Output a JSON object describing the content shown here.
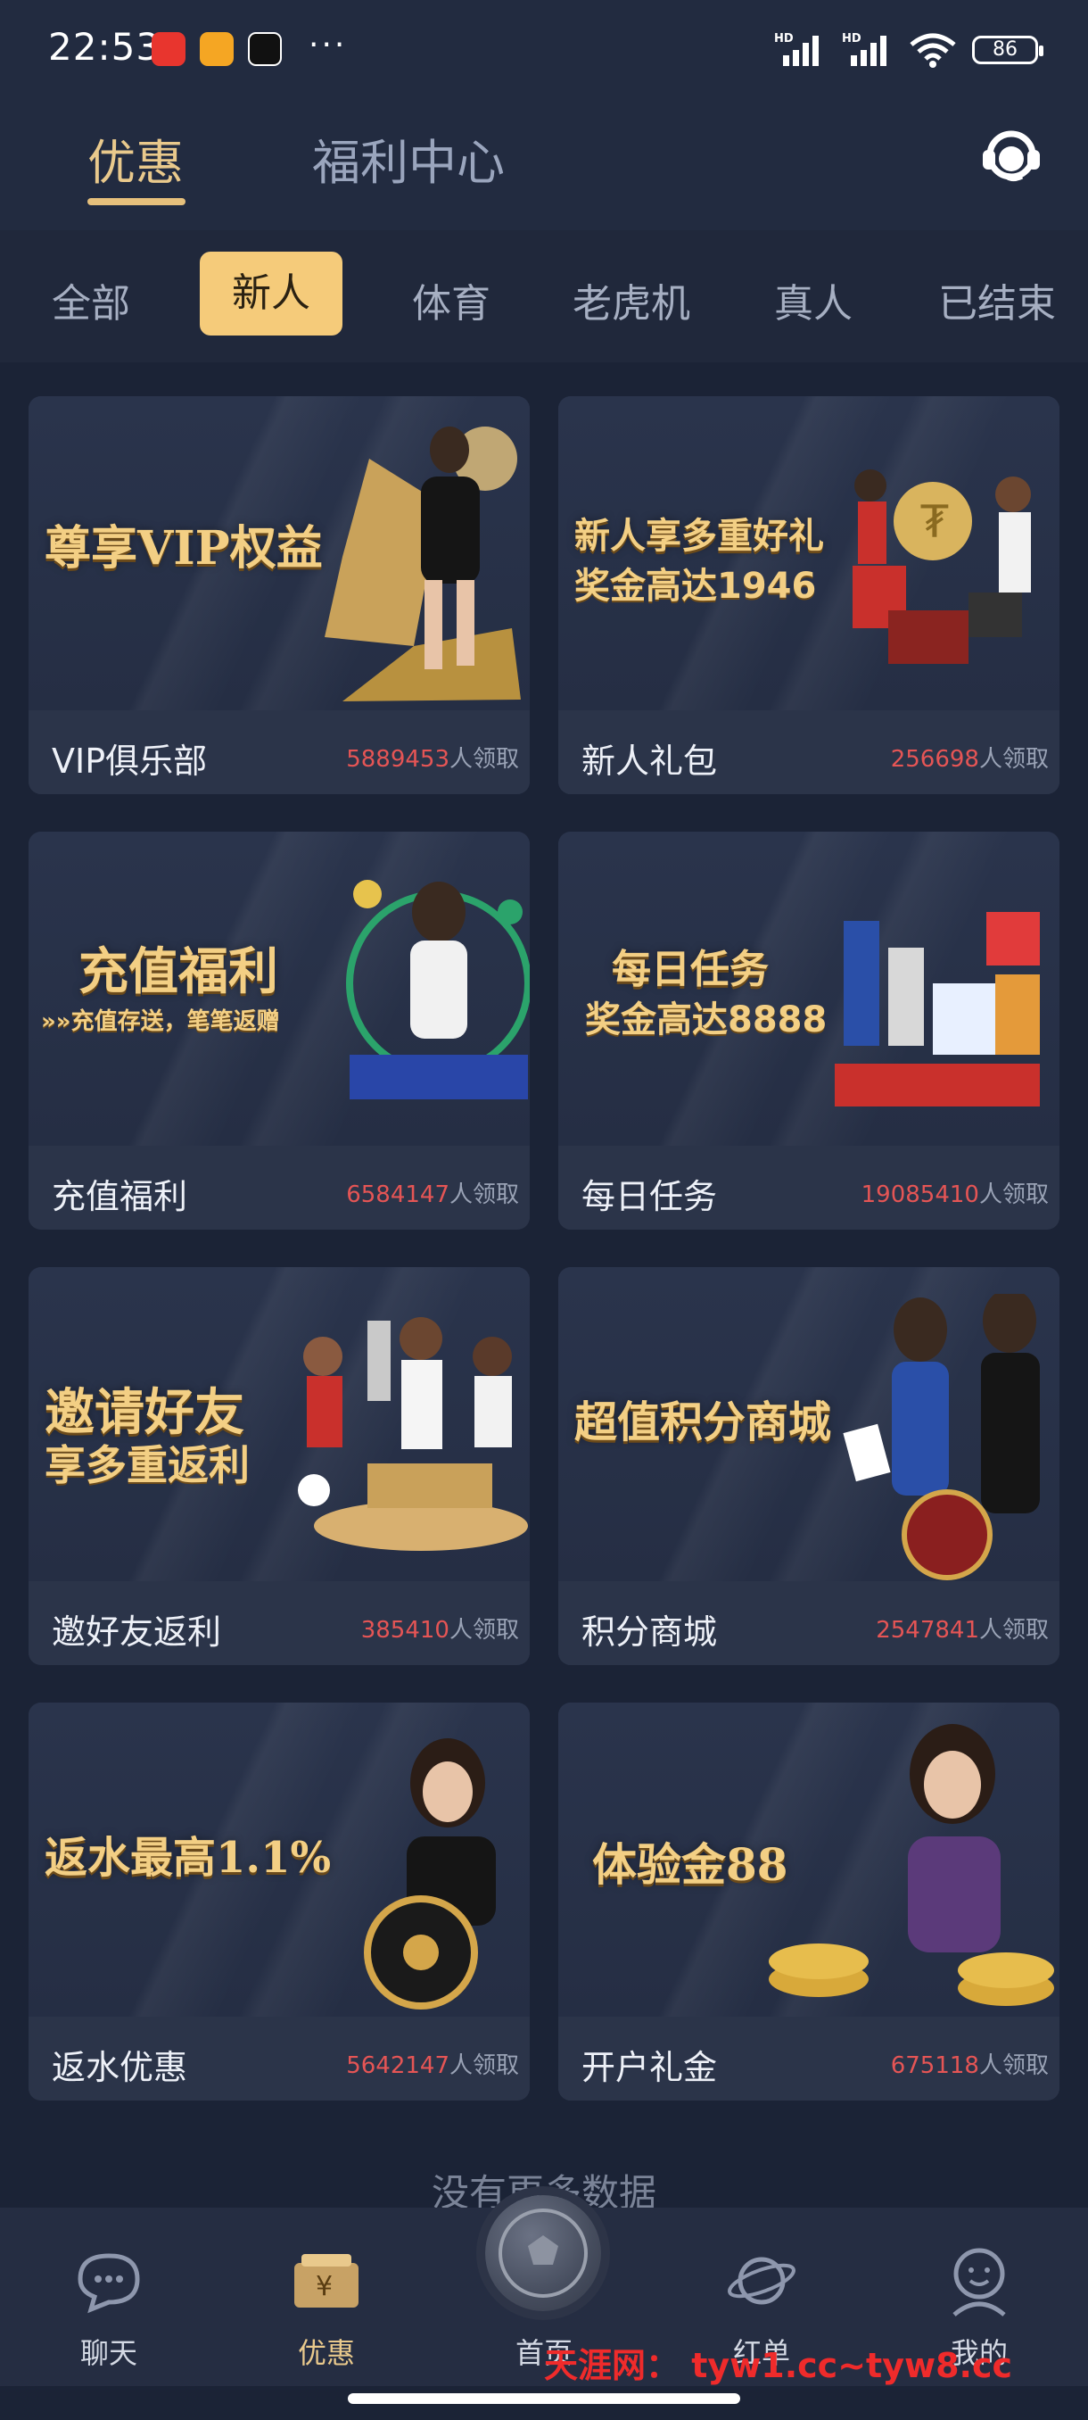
{
  "status_bar": {
    "time": "22:53",
    "more": "···",
    "signal_tag_1": "HD",
    "signal_tag_2": "HD",
    "battery": "86"
  },
  "top_tabs": [
    {
      "label": "优惠",
      "active": true
    },
    {
      "label": "福利中心",
      "active": false
    }
  ],
  "categories": [
    {
      "label": "全部"
    },
    {
      "label": "新人",
      "active": true
    },
    {
      "label": "体育"
    },
    {
      "label": "老虎机"
    },
    {
      "label": "真人"
    },
    {
      "label": "已结束"
    }
  ],
  "count_suffix": "人领取",
  "cards": [
    {
      "banner_title": "尊享VIP权益",
      "banner_sub": "",
      "name": "VIP俱乐部",
      "count": "5889453"
    },
    {
      "banner_title": "新人享多重好礼",
      "banner_sub": "奖金高达1946",
      "name": "新人礼包",
      "count": "256698"
    },
    {
      "banner_title": "充值福利",
      "banner_sub": "»»充值存送，笔笔返赠",
      "name": "充值福利",
      "count": "6584147"
    },
    {
      "banner_title": "每日任务",
      "banner_sub": "奖金高达8888",
      "name": "每日任务",
      "count": "19085410"
    },
    {
      "banner_title": "邀请好友",
      "banner_sub": "享多重返利",
      "name": "邀好友返利",
      "count": "385410"
    },
    {
      "banner_title": "超值积分商城",
      "banner_sub": "",
      "name": "积分商城",
      "count": "2547841"
    },
    {
      "banner_title": "返水最高1.1%",
      "banner_sub": "",
      "name": "返水优惠",
      "count": "5642147"
    },
    {
      "banner_title": "体验金88",
      "banner_sub": "",
      "name": "开户礼金",
      "count": "675118"
    }
  ],
  "no_more": "没有更多数据",
  "bottom_nav": [
    {
      "label": "聊天"
    },
    {
      "label": "优惠",
      "active": true
    },
    {
      "label": "首页"
    },
    {
      "label": "红单"
    },
    {
      "label": "我的"
    }
  ],
  "watermark": "天涯网： tyw1.cc~tyw8.cc",
  "colors": {
    "accent": "#f5cb7a",
    "count": "#e55555",
    "background": "#1b2336"
  }
}
